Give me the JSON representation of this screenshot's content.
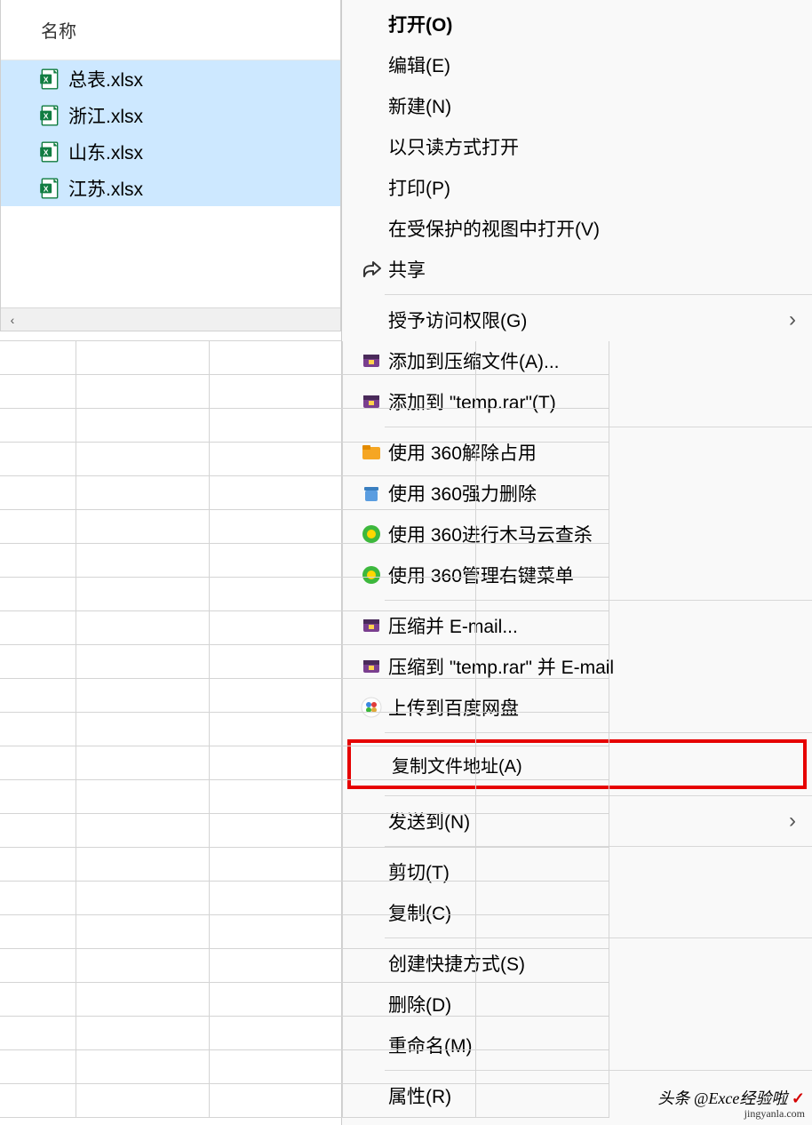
{
  "file_explorer": {
    "header": "名称",
    "files": [
      {
        "name": "总表.xlsx",
        "selected": true
      },
      {
        "name": "浙江.xlsx",
        "selected": true
      },
      {
        "name": "山东.xlsx",
        "selected": true
      },
      {
        "name": "江苏.xlsx",
        "selected": true
      }
    ]
  },
  "context_menu": {
    "groups": [
      [
        {
          "label": "打开(O)",
          "bold": true,
          "icon": null
        },
        {
          "label": "编辑(E)",
          "icon": null
        },
        {
          "label": "新建(N)",
          "icon": null
        },
        {
          "label": "以只读方式打开",
          "icon": null
        },
        {
          "label": "打印(P)",
          "icon": null
        },
        {
          "label": "在受保护的视图中打开(V)",
          "icon": null
        },
        {
          "label": "共享",
          "icon": "share-icon"
        }
      ],
      [
        {
          "label": "授予访问权限(G)",
          "icon": null,
          "submenu": true
        },
        {
          "label": "添加到压缩文件(A)...",
          "icon": "winrar-icon"
        },
        {
          "label": "添加到 \"temp.rar\"(T)",
          "icon": "winrar-icon"
        }
      ],
      [
        {
          "label": "使用 360解除占用",
          "icon": "folder360-icon"
        },
        {
          "label": "使用 360强力删除",
          "icon": "delete360-icon"
        },
        {
          "label": "使用 360进行木马云查杀",
          "icon": "360-icon"
        },
        {
          "label": "使用 360管理右键菜单",
          "icon": "360-icon"
        }
      ],
      [
        {
          "label": "压缩并 E-mail...",
          "icon": "winrar-icon"
        },
        {
          "label": "压缩到 \"temp.rar\" 并 E-mail",
          "icon": "winrar-icon"
        },
        {
          "label": "上传到百度网盘",
          "icon": "baidu-icon"
        }
      ],
      [
        {
          "label": "复制文件地址(A)",
          "icon": null,
          "highlighted": true
        }
      ],
      [
        {
          "label": "发送到(N)",
          "icon": null,
          "submenu": true
        }
      ],
      [
        {
          "label": "剪切(T)",
          "icon": null
        },
        {
          "label": "复制(C)",
          "icon": null
        }
      ],
      [
        {
          "label": "创建快捷方式(S)",
          "icon": null
        },
        {
          "label": "删除(D)",
          "icon": null
        },
        {
          "label": "重命名(M)",
          "icon": null
        }
      ],
      [
        {
          "label": "属性(R)",
          "icon": null
        }
      ]
    ]
  },
  "watermark": {
    "line1": "头条 @Exce经验啦",
    "line2": "jingyanla.com"
  }
}
